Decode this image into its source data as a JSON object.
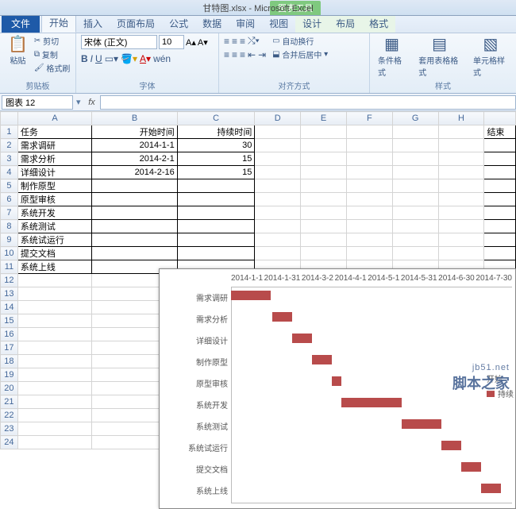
{
  "title": {
    "context_tool": "图表工具",
    "doc": "甘特图.xlsx - Microsoft Excel"
  },
  "tabs": {
    "file": "文件",
    "list": [
      "开始",
      "插入",
      "页面布局",
      "公式",
      "数据",
      "审阅",
      "视图"
    ],
    "ctx": [
      "设计",
      "布局",
      "格式"
    ]
  },
  "ribbon": {
    "clipboard": {
      "paste": "粘贴",
      "cut": "剪切",
      "copy": "复制",
      "brush": "格式刷",
      "label": "剪贴板"
    },
    "font": {
      "name": "宋体 (正文)",
      "size": "10",
      "label": "字体"
    },
    "align": {
      "wrap": "自动换行",
      "merge": "合并后居中",
      "label": "对齐方式"
    },
    "styles": {
      "cond": "条件格式",
      "table": "套用表格格式",
      "cell": "单元格样式",
      "label": "样式"
    }
  },
  "formula_bar": {
    "namebox": "图表 12"
  },
  "columns": [
    "A",
    "B",
    "C",
    "D",
    "E",
    "F",
    "G",
    "H"
  ],
  "last_col_header": "结束",
  "rows": [
    {
      "a": "任务",
      "b": "开始时间",
      "c": "持续时间"
    },
    {
      "a": "需求调研",
      "b": "2014-1-1",
      "c": "30"
    },
    {
      "a": "需求分析",
      "b": "2014-2-1",
      "c": "15"
    },
    {
      "a": "详细设计",
      "b": "2014-2-16",
      "c": "15"
    },
    {
      "a": "制作原型",
      "b": "",
      "c": ""
    },
    {
      "a": "原型审核",
      "b": "",
      "c": ""
    },
    {
      "a": "系统开发",
      "b": "",
      "c": ""
    },
    {
      "a": "系统测试",
      "b": "",
      "c": ""
    },
    {
      "a": "系统试运行",
      "b": "",
      "c": ""
    },
    {
      "a": "提交文档",
      "b": "",
      "c": ""
    },
    {
      "a": "系统上线",
      "b": "",
      "c": ""
    }
  ],
  "chart_data": {
    "type": "bar",
    "orientation": "horizontal-stacked",
    "x_ticks": [
      "2014-1-1",
      "2014-1-31",
      "2014-3-2",
      "2014-4-1",
      "2014-5-1",
      "2014-5-31",
      "2014-6-30",
      "2014-7-30"
    ],
    "x_range_days": [
      0,
      210
    ],
    "categories": [
      "需求调研",
      "需求分析",
      "详细设计",
      "制作原型",
      "原型审核",
      "系统开发",
      "系统测试",
      "系统试运行",
      "提交文档",
      "系统上线"
    ],
    "series": [
      {
        "name": "开始时间",
        "role": "offset-transparent",
        "values_days_from_start": [
          0,
          31,
          46,
          61,
          76,
          83,
          128,
          158,
          173,
          188
        ]
      },
      {
        "name": "持续时间",
        "role": "duration",
        "color": "#b84b4b",
        "values_days": [
          30,
          15,
          15,
          15,
          7,
          45,
          30,
          15,
          15,
          15
        ]
      }
    ],
    "legend": [
      "开始",
      "持续"
    ]
  },
  "watermark": {
    "line1": "jb51.net",
    "line2": "脚本之家"
  }
}
